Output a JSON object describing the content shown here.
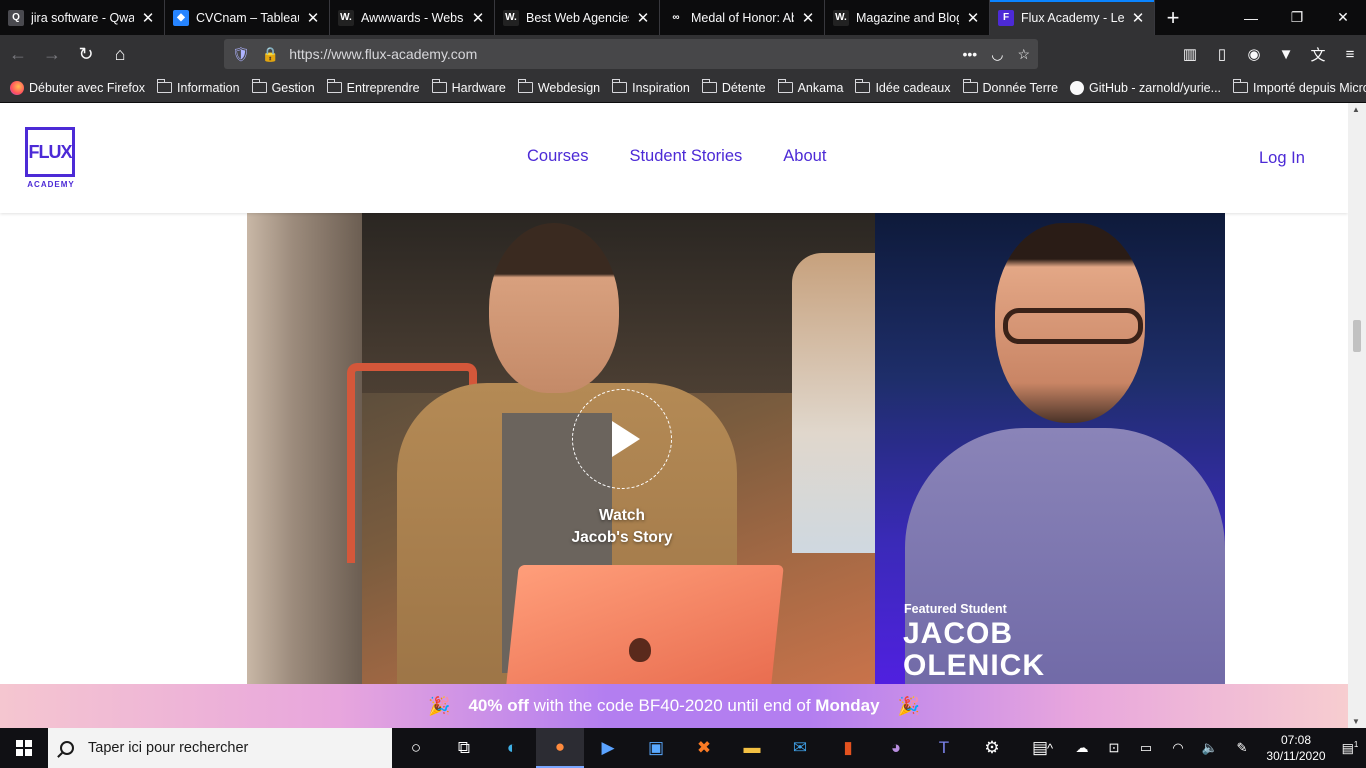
{
  "browser": {
    "tabs": [
      {
        "label": "jira software - Qwant",
        "favicon": "Q",
        "favicon_bg": "#4a4a4f",
        "active": false
      },
      {
        "label": "CVCnam – Tableau Ag",
        "favicon": "◆",
        "favicon_bg": "#2684ff",
        "active": false
      },
      {
        "label": "Awwwards - Website",
        "favicon": "W.",
        "favicon_bg": "#222222",
        "active": false
      },
      {
        "label": "Best Web Agencies in",
        "favicon": "W.",
        "favicon_bg": "#222222",
        "active": false
      },
      {
        "label": "Medal of Honor: Abov",
        "favicon": "∞",
        "favicon_bg": "#0c0c0d",
        "active": false
      },
      {
        "label": "Magazine and Blog",
        "favicon": "W.",
        "favicon_bg": "#222222",
        "active": false
      },
      {
        "label": "Flux Academy - Lear",
        "favicon": "F",
        "favicon_bg": "#4c2ad6",
        "active": true
      }
    ],
    "url": "https://www.flux-academy.com",
    "bookmarks": [
      {
        "label": "Débuter avec Firefox",
        "icon": "firefox-icon"
      },
      {
        "label": "Information",
        "icon": "folder-icon"
      },
      {
        "label": "Gestion",
        "icon": "folder-icon"
      },
      {
        "label": "Entreprendre",
        "icon": "folder-icon"
      },
      {
        "label": "Hardware",
        "icon": "folder-icon"
      },
      {
        "label": "Webdesign",
        "icon": "folder-icon"
      },
      {
        "label": "Inspiration",
        "icon": "folder-icon"
      },
      {
        "label": "Détente",
        "icon": "folder-icon"
      },
      {
        "label": "Ankama",
        "icon": "folder-icon"
      },
      {
        "label": "Idée cadeaux",
        "icon": "folder-icon"
      },
      {
        "label": "Donnée Terre",
        "icon": "folder-icon"
      },
      {
        "label": "GitHub - zarnold/yurie...",
        "icon": "github-icon"
      },
      {
        "label": "Importé depuis Micros...",
        "icon": "folder-icon"
      }
    ]
  },
  "site": {
    "logo_text": "FLUX",
    "logo_subtext": "ACADEMY",
    "nav": [
      "Courses",
      "Student Stories",
      "About"
    ],
    "login": "Log In",
    "accent": "#4c2ad6",
    "video": {
      "watch_line1": "Watch",
      "watch_line2": "Jacob's Story"
    },
    "featured": {
      "label": "Featured Student",
      "first_name": "JACOB",
      "last_name": "OLENICK"
    },
    "promo": {
      "discount": "40% off",
      "middle": "with the code BF40-2020 until end of",
      "day": "Monday"
    }
  },
  "taskbar": {
    "search_placeholder": "Taper ici pour rechercher",
    "time": "07:08",
    "date": "30/11/2020",
    "notification_count": "1"
  }
}
